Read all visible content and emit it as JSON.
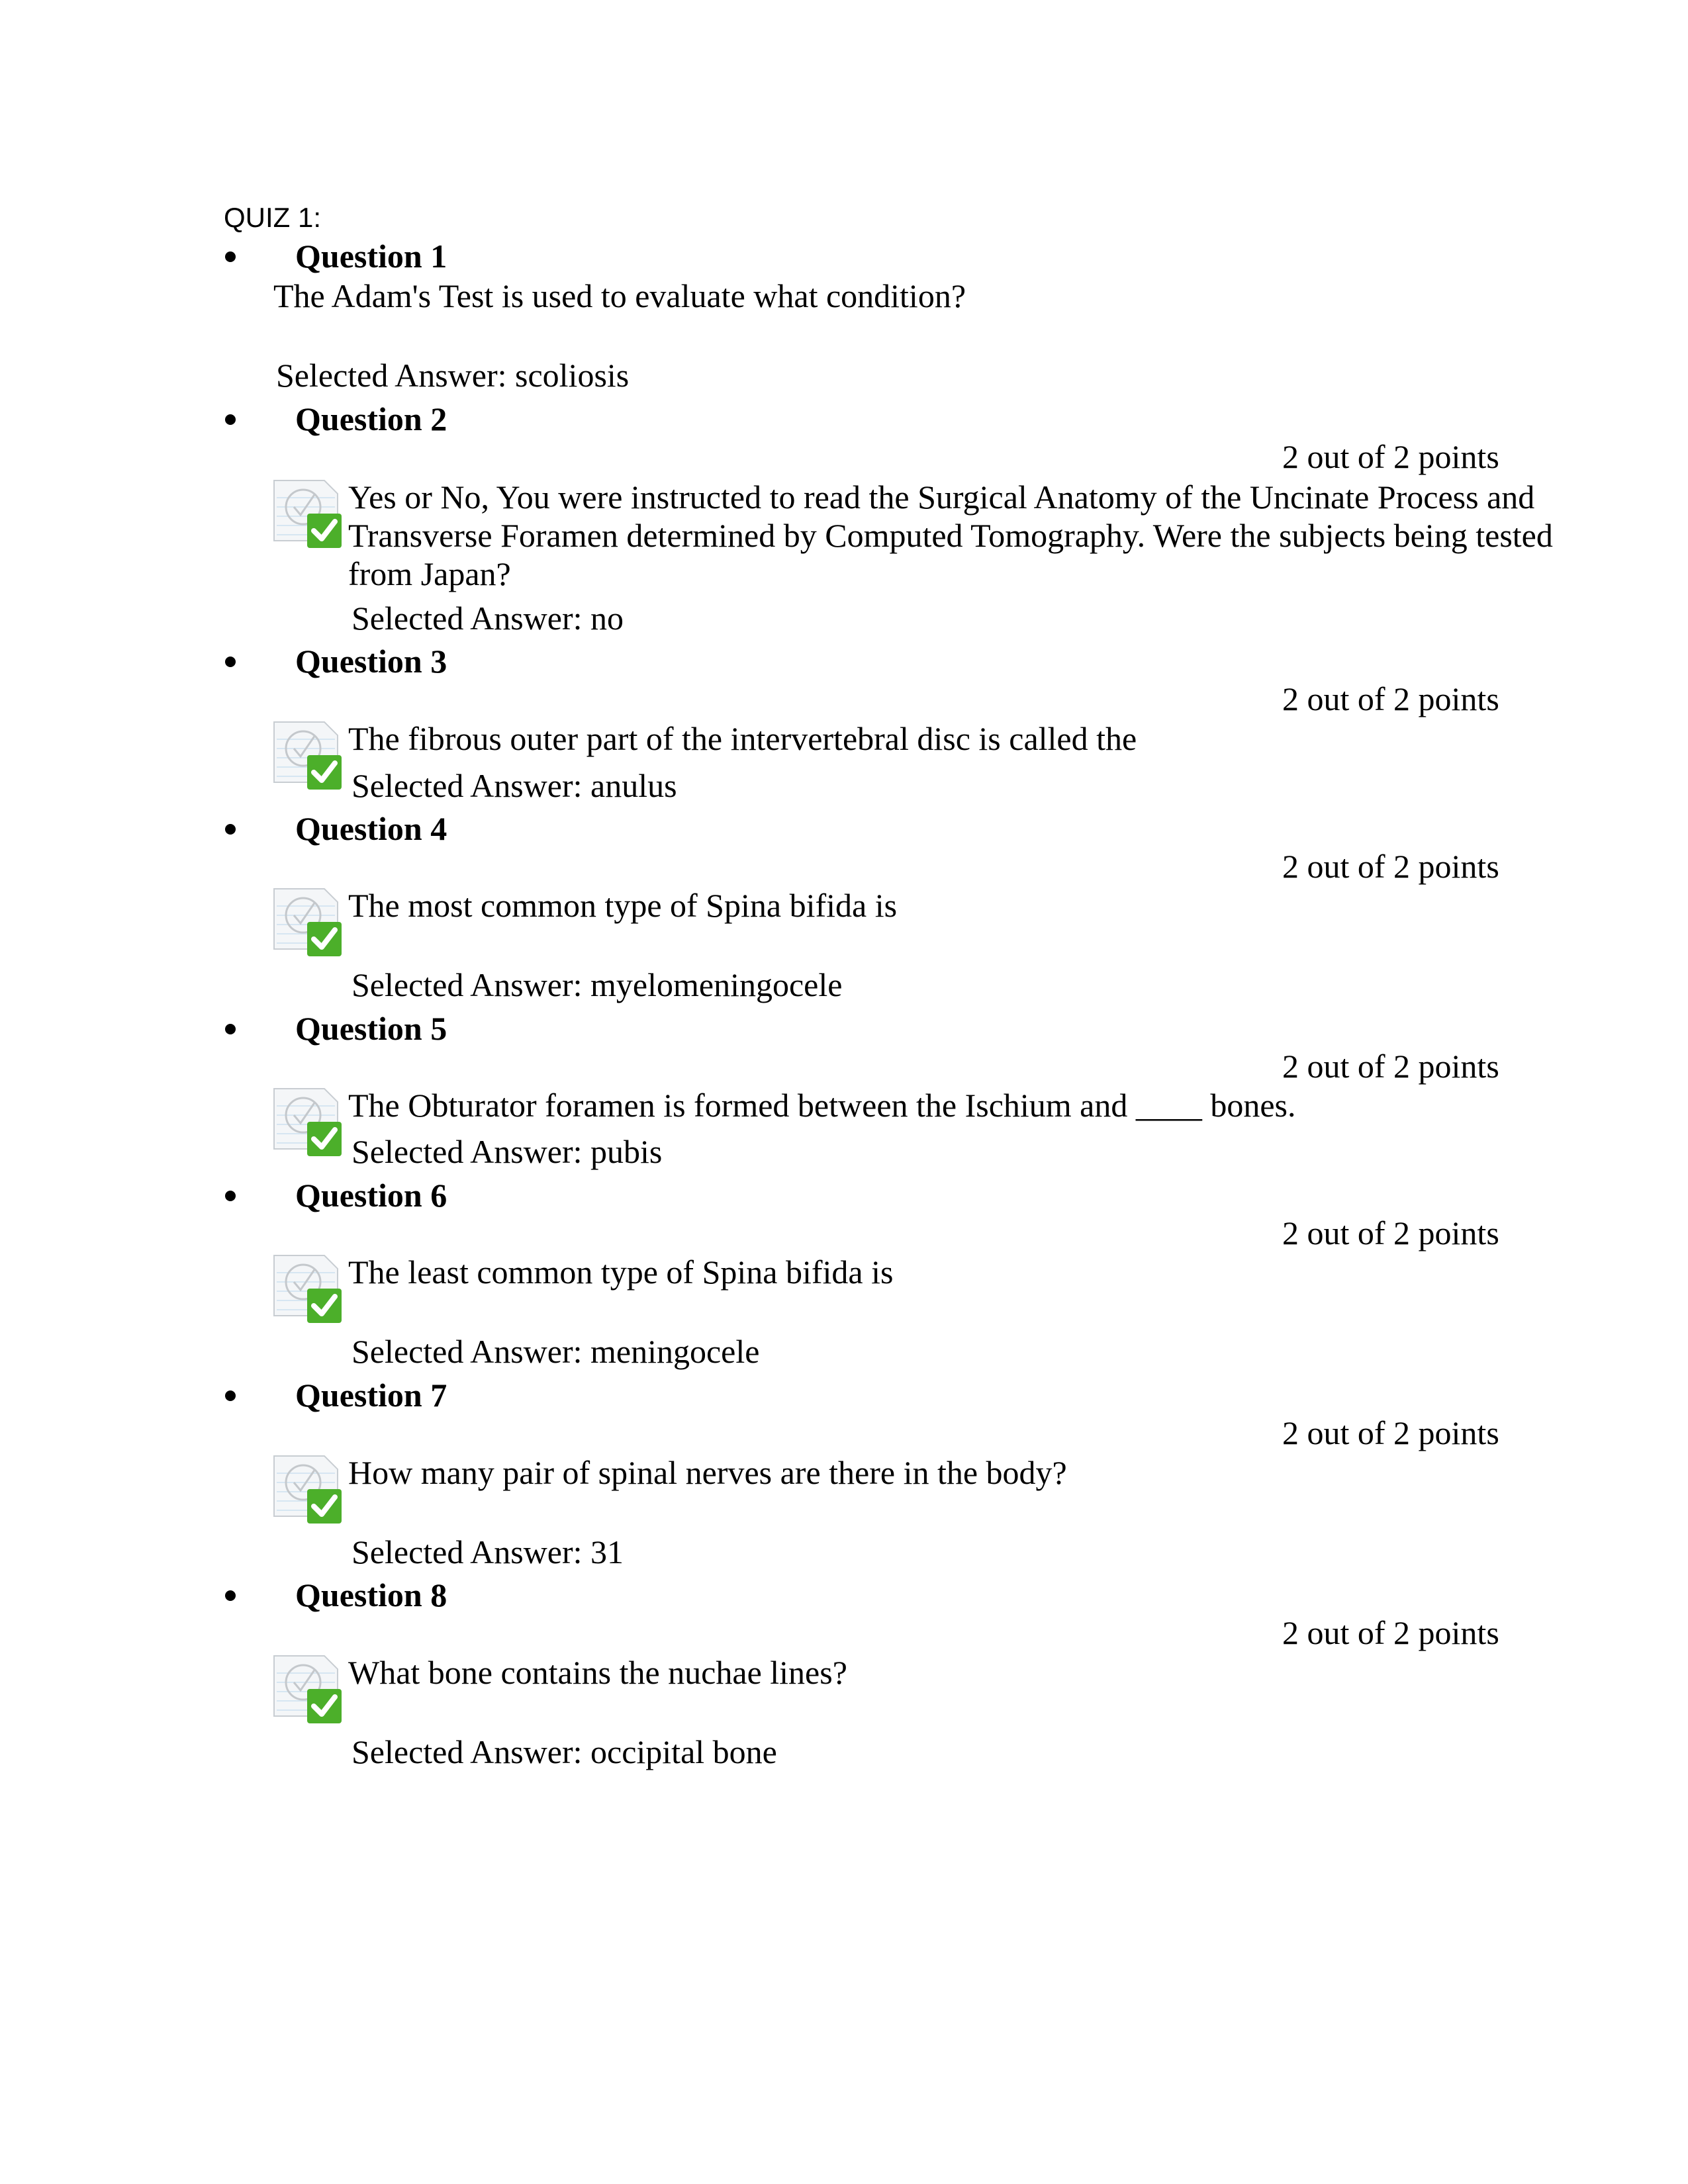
{
  "document": {
    "title": "QUIZ 1:",
    "answer_prefix": "Selected Answer: ",
    "icon": "correct-answer-icon",
    "accent_color": "#4caf2a"
  },
  "questions": [
    {
      "heading": "Question 1",
      "points": null,
      "text": "The Adam's Test is used to evaluate what condition?",
      "selected_answer": "Selected Answer: scoliosis",
      "has_icon": false
    },
    {
      "heading": "Question 2",
      "points": "2 out of 2 points",
      "text": "Yes or No, You were instructed to read the Surgical Anatomy of the Uncinate Process and Transverse Foramen determined by Computed Tomography. Were the subjects being tested from Japan?",
      "selected_answer": "Selected Answer: no",
      "has_icon": true
    },
    {
      "heading": "Question 3",
      "points": "2 out of 2 points",
      "text": "The fibrous outer part of the intervertebral disc is called the",
      "selected_answer": "Selected Answer: anulus",
      "has_icon": true
    },
    {
      "heading": "Question 4",
      "points": "2 out of 2 points",
      "text": "The most common type of Spina bifida is",
      "selected_answer": "Selected Answer: myelomeningocele",
      "has_icon": true
    },
    {
      "heading": "Question 5",
      "points": "2 out of 2 points",
      "text": "The Obturator foramen is formed between the Ischium and ____ bones.",
      "selected_answer": "Selected Answer: pubis",
      "has_icon": true
    },
    {
      "heading": "Question 6",
      "points": "2 out of 2 points",
      "text": "The least common type of Spina bifida is",
      "selected_answer": "Selected Answer: meningocele",
      "has_icon": true
    },
    {
      "heading": "Question 7",
      "points": "2 out of 2 points",
      "text": "How many pair of spinal nerves are there in the body?",
      "selected_answer": "Selected Answer: 31",
      "has_icon": true
    },
    {
      "heading": "Question 8",
      "points": "2 out of 2 points",
      "text": "What bone contains the nuchae lines?",
      "selected_answer": "Selected Answer: occipital bone",
      "has_icon": true
    }
  ]
}
